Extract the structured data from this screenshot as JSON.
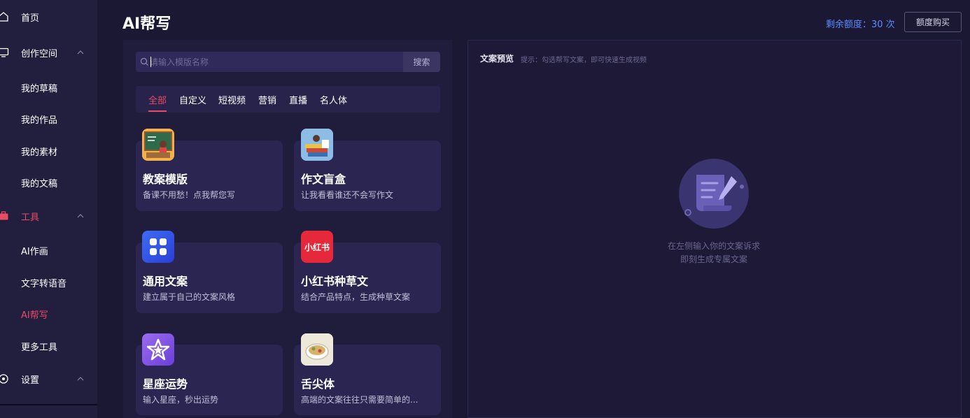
{
  "sidebar": {
    "items": [
      {
        "label": "首页",
        "icon": "home-icon"
      },
      {
        "label": "创作空间",
        "icon": "monitor-icon"
      },
      {
        "label": "我的草稿"
      },
      {
        "label": "我的作品"
      },
      {
        "label": "我的素材"
      },
      {
        "label": "我的文稿"
      },
      {
        "label": "工具",
        "icon": "toolbox-icon"
      },
      {
        "label": "AI作画"
      },
      {
        "label": "文字转语音"
      },
      {
        "label": "AI帮写"
      },
      {
        "label": "更多工具"
      },
      {
        "label": "设置",
        "icon": "gear-icon"
      }
    ],
    "active_color": "#e84b66"
  },
  "header": {
    "title": "AI帮写",
    "quota": "剩余额度：30 次",
    "buy_label": "额度购买"
  },
  "search": {
    "placeholder": "请输入模版名称",
    "button": "搜索"
  },
  "tabs": [
    "全部",
    "自定义",
    "短视频",
    "营销",
    "直播",
    "名人体"
  ],
  "cards": [
    {
      "title": "教案模版",
      "desc": "备课不用愁！点我帮您写",
      "icon": "teacher-blackboard-icon"
    },
    {
      "title": "作文盲盒",
      "desc": "让我看看谁还不会写作文",
      "icon": "books-reading-icon"
    },
    {
      "title": "通用文案",
      "desc": "建立属于自己的文案风格",
      "icon": "apps-grid-icon"
    },
    {
      "title": "小红书种草文",
      "desc": "结合产品特点，生成种草文案",
      "icon": "xiaohongshu-logo-icon",
      "icon_text": "小红书"
    },
    {
      "title": "星座运势",
      "desc": "输入星座，秒出运势",
      "icon": "star-icon"
    },
    {
      "title": "舌尖体",
      "desc": "高端的文案往往只需要简单的...",
      "icon": "food-bowl-icon"
    }
  ],
  "preview": {
    "title": "文案预览",
    "hint": "提示：勾选帮写文案，即可快速生成视频",
    "empty_line1": "在左侧输入你的文案诉求",
    "empty_line2": "即刻生成专属文案"
  }
}
